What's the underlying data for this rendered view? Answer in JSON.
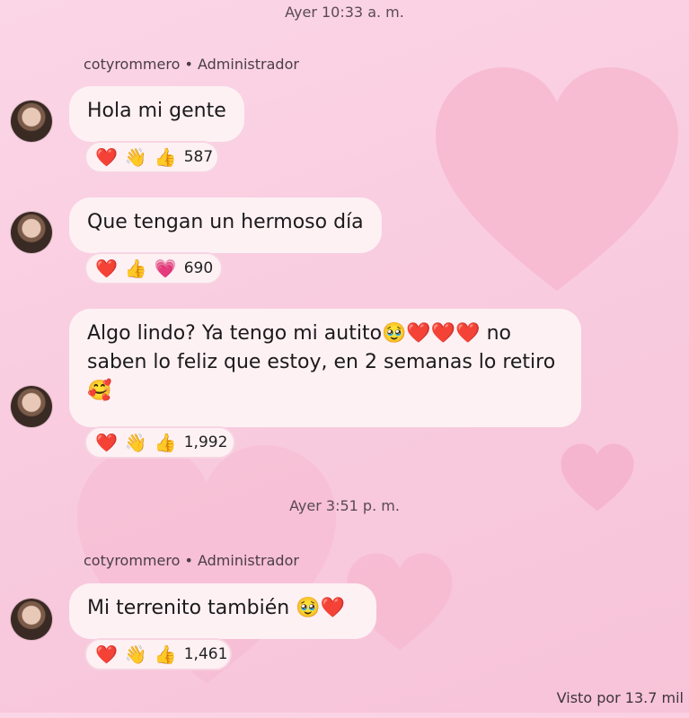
{
  "timestamps": [
    "Ayer 10:33 a. m.",
    "Ayer 3:51 p. m."
  ],
  "sender": "cotyrommero • Administrador",
  "messages": [
    {
      "text": "Hola mi gente",
      "reactions": [
        "❤️",
        "👋",
        "👍"
      ],
      "count": "587"
    },
    {
      "text": "Que tengan un hermoso día",
      "reactions": [
        "❤️",
        "👍",
        "💗"
      ],
      "count": "690"
    },
    {
      "text": "Algo lindo? Ya tengo mi autito🥹❤️❤️❤️ no saben lo feliz que estoy, en 2 semanas lo retiro 🥰",
      "reactions": [
        "❤️",
        "👋",
        "👍"
      ],
      "count": "1,992"
    },
    {
      "text": "Mi terrenito también 🥹❤️",
      "reactions": [
        "❤️",
        "👋",
        "👍"
      ],
      "count": "1,461"
    }
  ],
  "seen": "Visto por 13.7 mil",
  "colors": {
    "bubble": "#fdf1f4",
    "background": "#f9cde0",
    "heart": "#f7a9c6"
  }
}
